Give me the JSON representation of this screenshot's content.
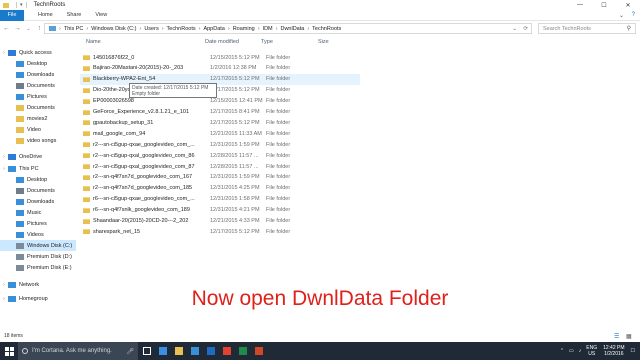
{
  "window": {
    "title": "TechnRoots",
    "minimize": "—",
    "maximize": "☐",
    "close": "✕"
  },
  "ribbon": {
    "tabs": [
      "File",
      "Home",
      "Share",
      "View"
    ]
  },
  "address": {
    "crumbs": [
      "This PC",
      "Windows Disk (C:)",
      "Users",
      "TechnRoots",
      "AppData",
      "Roaming",
      "IDM",
      "DwnlData",
      "TechnRoots"
    ],
    "search_placeholder": "Search TechnRoots"
  },
  "columns": {
    "name": "Name",
    "date": "Date modified",
    "type": "Type",
    "size": "Size"
  },
  "sidebar": {
    "items": [
      {
        "label": "Quick access",
        "icon": "star-icon",
        "color": "#2f7bd6"
      },
      {
        "label": "Desktop",
        "icon": "desktop-icon",
        "color": "#3a8fd9"
      },
      {
        "label": "Downloads",
        "icon": "download-icon",
        "color": "#3a8fd9"
      },
      {
        "label": "Documents",
        "icon": "documents-icon",
        "color": "#6e7c8c"
      },
      {
        "label": "Pictures",
        "icon": "pictures-icon",
        "color": "#3a8fd9"
      },
      {
        "label": "Documents",
        "icon": "folder-icon",
        "color": "#e8c050"
      },
      {
        "label": "movies2",
        "icon": "folder-icon",
        "color": "#e8c050"
      },
      {
        "label": "Video",
        "icon": "folder-icon",
        "color": "#e8c050"
      },
      {
        "label": "video songs",
        "icon": "folder-icon",
        "color": "#e8c050"
      },
      {
        "label": "OneDrive",
        "icon": "cloud-icon",
        "color": "#2f7bd6"
      },
      {
        "label": "This PC",
        "icon": "computer-icon",
        "color": "#3a8fd9"
      },
      {
        "label": "Desktop",
        "icon": "desktop-icon",
        "color": "#3a8fd9"
      },
      {
        "label": "Documents",
        "icon": "documents-icon",
        "color": "#6e7c8c"
      },
      {
        "label": "Downloads",
        "icon": "download-icon",
        "color": "#3a8fd9"
      },
      {
        "label": "Music",
        "icon": "music-icon",
        "color": "#3a8fd9"
      },
      {
        "label": "Pictures",
        "icon": "pictures-icon",
        "color": "#3a8fd9"
      },
      {
        "label": "Videos",
        "icon": "video-icon",
        "color": "#3a8fd9"
      },
      {
        "label": "Windows Disk (C:)",
        "icon": "disk-icon",
        "color": "#7c8a99"
      },
      {
        "label": "Premium Disk (D:)",
        "icon": "disk-icon",
        "color": "#7c8a99"
      },
      {
        "label": "Premium Disk (E:)",
        "icon": "disk-icon",
        "color": "#7c8a99"
      },
      {
        "label": "Network",
        "icon": "network-icon",
        "color": "#3a8fd9"
      },
      {
        "label": "Homegroup",
        "icon": "homegroup-icon",
        "color": "#3a8fd9"
      }
    ]
  },
  "files": [
    {
      "name": "145016876f22_0",
      "date": "12/15/2015 5:12 PM",
      "type": "File folder"
    },
    {
      "name": "Bajirao-20Mastani-20(2015)-20-_203",
      "date": "1/2/2016 12:38 PM",
      "type": "File folder"
    },
    {
      "name": "Blackberry-WPA2-Ent_54",
      "date": "12/17/2015 5:12 PM",
      "type": "File folder"
    },
    {
      "name": "Dio-20the-20your",
      "date": "12/17/2015 5:12 PM",
      "type": "File folder"
    },
    {
      "name": "EP00003026598",
      "date": "12/15/2015 12:41 PM",
      "type": "File folder"
    },
    {
      "name": "GeForce_Experience_v2.8.1.21_e_101",
      "date": "12/17/2015 8:41 PM",
      "type": "File folder"
    },
    {
      "name": "gpautobackup_setup_31",
      "date": "12/17/2015 5:12 PM",
      "type": "File folder"
    },
    {
      "name": "mail_google_com_94",
      "date": "12/21/2015 11:33 AM",
      "type": "File folder"
    },
    {
      "name": "r2---sn-ci5gup-qxae_googlevideo_com_...",
      "date": "12/31/2015 1:59 PM",
      "type": "File folder"
    },
    {
      "name": "r2---sn-ci5gup-qxal_googlevideo_com_86",
      "date": "12/28/2015 11:57 ...",
      "type": "File folder"
    },
    {
      "name": "r2---sn-ci5gup-qxal_googlevideo_com_87",
      "date": "12/28/2015 11:57 ...",
      "type": "File folder"
    },
    {
      "name": "r2---sn-q4f7sn7d_googlevideo_com_167",
      "date": "12/31/2015 1:59 PM",
      "type": "File folder"
    },
    {
      "name": "r2---sn-q4f7sn7d_googlevideo_com_185",
      "date": "12/31/2015 4:25 PM",
      "type": "File folder"
    },
    {
      "name": "r6---sn-ci5gup-qxae_googlevideo_com_...",
      "date": "12/31/2015 1:58 PM",
      "type": "File folder"
    },
    {
      "name": "r6---sn-q4f7snlk_googlevideo_com_189",
      "date": "12/31/2015 4:21 PM",
      "type": "File folder"
    },
    {
      "name": "Shaandaar-20(2015)-20CD-20---2_202",
      "date": "12/21/2015 4:33 PM",
      "type": "File folder"
    },
    {
      "name": "sharespark_net_15",
      "date": "12/17/2015 5:12 PM",
      "type": "File folder"
    }
  ],
  "tooltip": {
    "line1": "Date created: 12/17/2015 5:12 PM",
    "line2": "Empty folder"
  },
  "status": {
    "count": "18 items"
  },
  "caption": "Now open DwnlData Folder",
  "taskbar": {
    "cortana": "I'm Cortana. Ask me anything.",
    "lang": "ENG",
    "region": "US",
    "time": "12:42 PM",
    "date": "1/2/2016",
    "apps": [
      {
        "icon": "task-view-icon",
        "color": "#ffffff"
      },
      {
        "icon": "edge-icon",
        "color": "#3b8fe3"
      },
      {
        "icon": "explorer-icon",
        "color": "#e8c050"
      },
      {
        "icon": "store-icon",
        "color": "#3a8fd9"
      },
      {
        "icon": "outlook-icon",
        "color": "#1f6bc2"
      },
      {
        "icon": "chrome-icon",
        "color": "#e44134"
      },
      {
        "icon": "excel-icon",
        "color": "#1f8a4a"
      },
      {
        "icon": "powerpoint-icon",
        "color": "#d24726"
      }
    ]
  }
}
